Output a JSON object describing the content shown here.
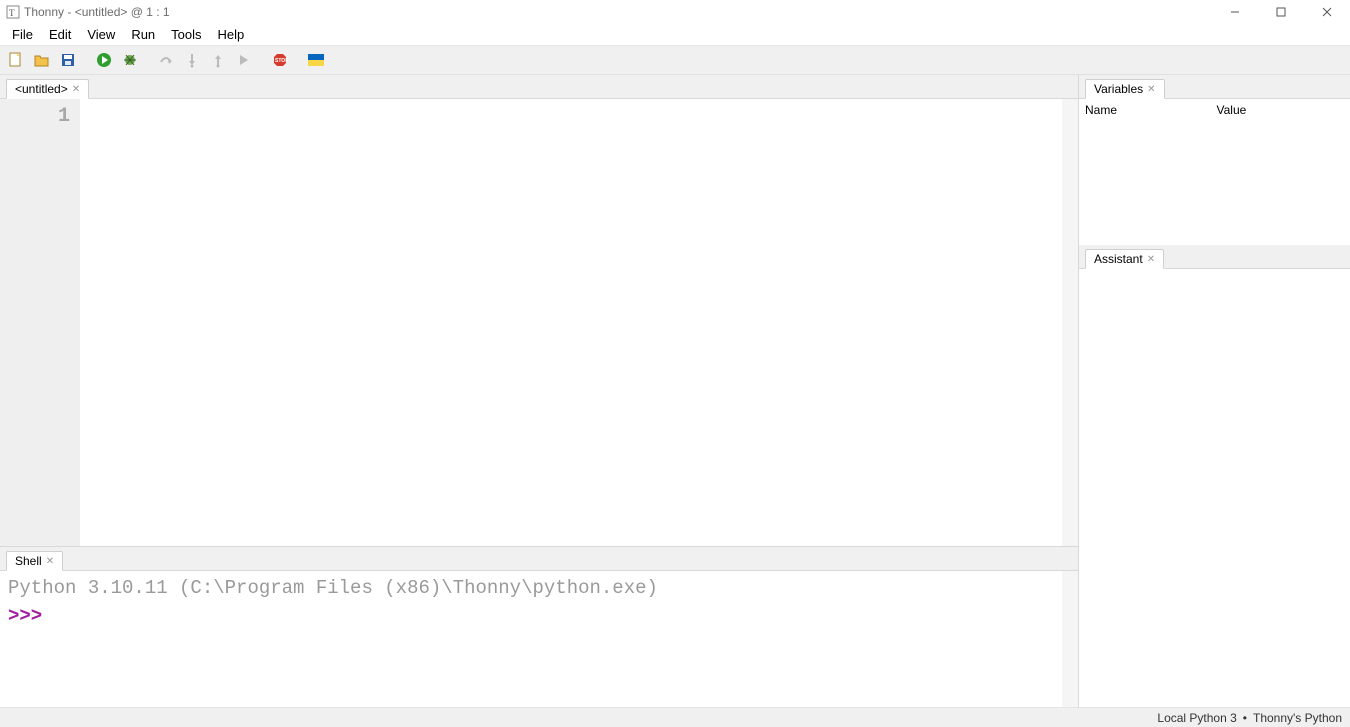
{
  "title": "Thonny  -  <untitled>  @  1 : 1",
  "menus": [
    "File",
    "Edit",
    "View",
    "Run",
    "Tools",
    "Help"
  ],
  "editor_tab": "<untitled>",
  "gutter_line": "1",
  "shell_tab": "Shell",
  "shell_version_line": "Python 3.10.11 (C:\\Program Files (x86)\\Thonny\\python.exe)",
  "shell_prompt": ">>>",
  "vars_tab": "Variables",
  "vars_cols": {
    "name": "Name",
    "value": "Value"
  },
  "assist_tab": "Assistant",
  "status": {
    "interp": "Local Python 3",
    "sep": "•",
    "detail": "Thonny's Python"
  }
}
